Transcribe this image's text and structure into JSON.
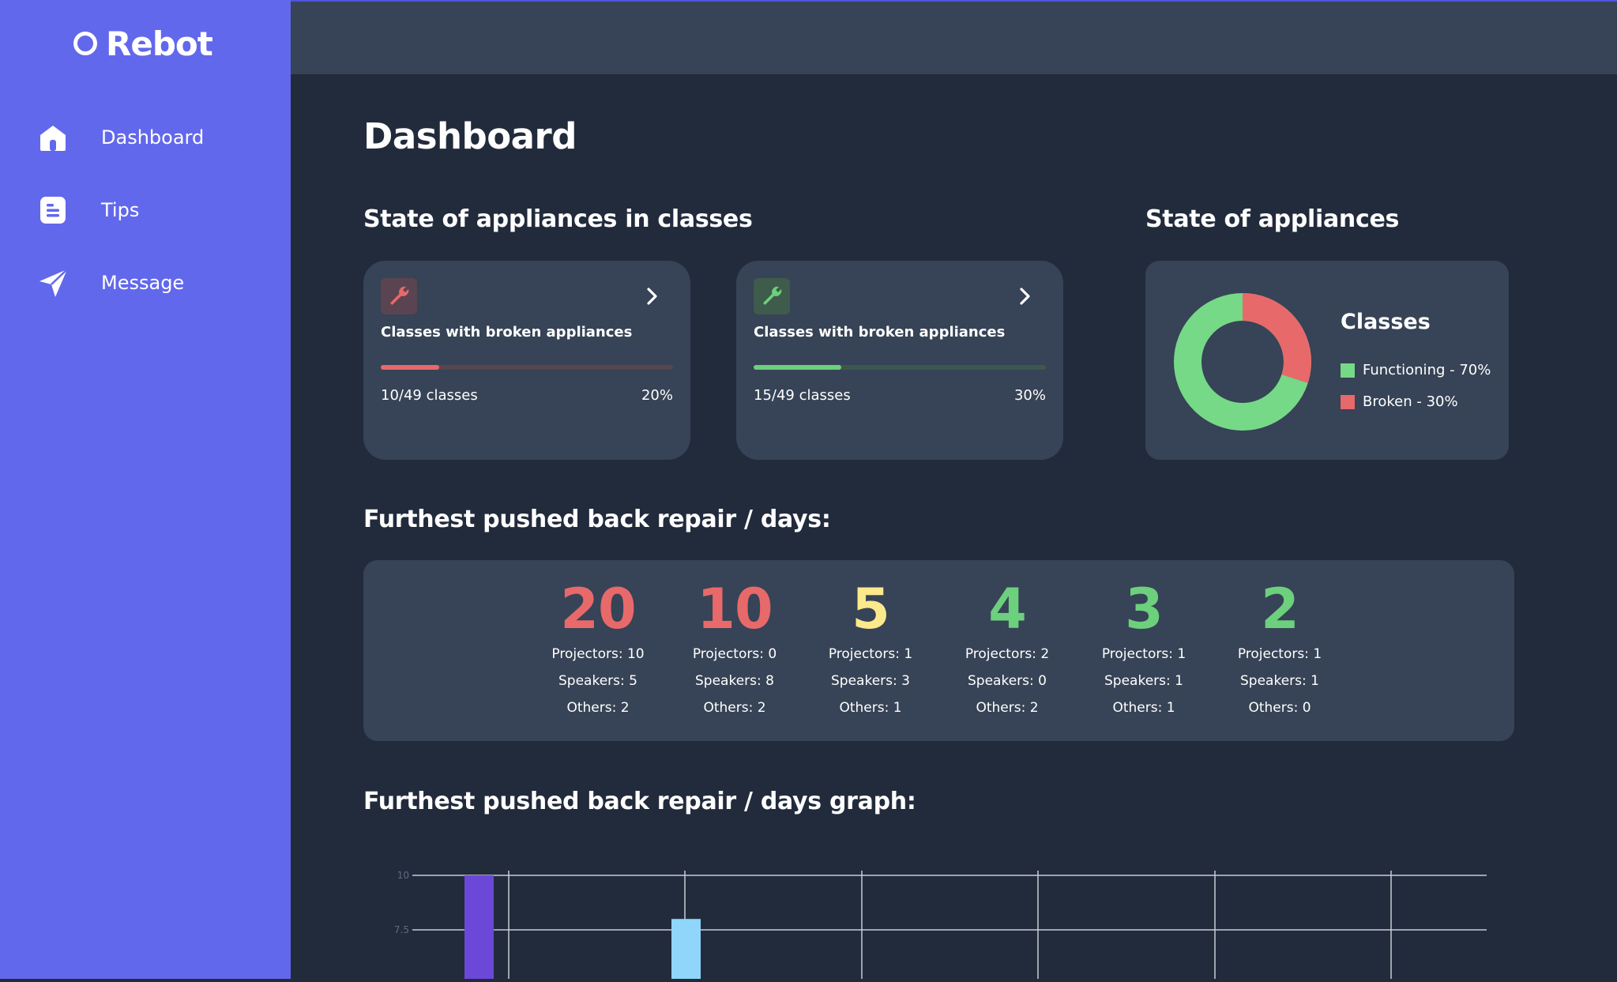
{
  "app": {
    "name": "Rebot"
  },
  "sidebar": {
    "items": [
      {
        "label": "Dashboard",
        "icon": "home-icon"
      },
      {
        "label": "Tips",
        "icon": "document-icon"
      },
      {
        "label": "Message",
        "icon": "paper-plane-icon"
      }
    ]
  },
  "page": {
    "title": "Dashboard"
  },
  "sections": {
    "classes": "State of appliances in classes",
    "appliances": "State of appliances",
    "repair": "Furthest pushed back repair / days:",
    "graph": "Furthest pushed back repair / days graph:"
  },
  "stat_cards": [
    {
      "label": "Classes with broken appliances",
      "count": "10/49 classes",
      "percent": "20%",
      "progress": 0.2,
      "color": "#e8696a",
      "track": "#5a4451",
      "tile": "#5a4451"
    },
    {
      "label": "Classes with broken appliances",
      "count": "15/49 classes",
      "percent": "30%",
      "progress": 0.3,
      "color": "#6cd07d",
      "track": "#3c584d",
      "tile": "#3f5b4c"
    }
  ],
  "donut": {
    "title": "Classes",
    "slices": [
      {
        "label": "Functioning - 70%",
        "value": 70,
        "color": "#76d987"
      },
      {
        "label": "Broken - 30%",
        "value": 30,
        "color": "#e8696a"
      }
    ]
  },
  "repairs": [
    {
      "days": "20",
      "color": "#e8696a",
      "projectors": "Projectors: 10",
      "speakers": "Speakers: 5",
      "others": "Others: 2"
    },
    {
      "days": "10",
      "color": "#e8696a",
      "projectors": "Projectors: 0",
      "speakers": "Speakers: 8",
      "others": "Others: 2"
    },
    {
      "days": "5",
      "color": "#fbe98c",
      "projectors": "Projectors: 1",
      "speakers": "Speakers: 3",
      "others": "Others: 1"
    },
    {
      "days": "4",
      "color": "#6cd07d",
      "projectors": "Projectors: 2",
      "speakers": "Speakers: 0",
      "others": "Others: 2"
    },
    {
      "days": "3",
      "color": "#6cd07d",
      "projectors": "Projectors: 1",
      "speakers": "Speakers: 1",
      "others": "Others: 1"
    },
    {
      "days": "2",
      "color": "#6cd07d",
      "projectors": "Projectors: 1",
      "speakers": "Speakers: 1",
      "others": "Others: 0"
    }
  ],
  "chart_data": {
    "type": "bar",
    "title": "Furthest pushed back repair / days graph:",
    "y_ticks": [
      "10",
      "7.5"
    ],
    "ylim_visible": [
      7.5,
      10
    ],
    "series": [
      {
        "name": "",
        "color": "#6b48d8",
        "values": [
          10
        ]
      },
      {
        "name": "",
        "color": "#8fd6fa",
        "values": [
          8
        ]
      }
    ],
    "grid": true
  }
}
